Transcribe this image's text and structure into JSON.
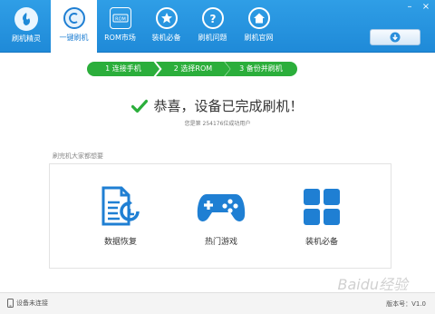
{
  "brand": {
    "name": "刷机精灵"
  },
  "nav": [
    {
      "label": "一键刷机",
      "icon": "flash-c-icon",
      "active": true
    },
    {
      "label": "ROM市场",
      "icon": "rom-chip-icon",
      "active": false
    },
    {
      "label": "装机必备",
      "icon": "star-icon",
      "active": false
    },
    {
      "label": "刷机问题",
      "icon": "question-icon",
      "active": false
    },
    {
      "label": "刷机官网",
      "icon": "home-icon",
      "active": false
    }
  ],
  "window_controls": {
    "minimize": "–",
    "close": "×"
  },
  "steps": [
    {
      "label": "1  连接手机"
    },
    {
      "label": "2  选择ROM"
    },
    {
      "label": "3  备份并刷机"
    }
  ],
  "success": {
    "message": "恭喜，设备已完成刷机！",
    "sub": "您是第 254176位成功用户"
  },
  "panel": {
    "title": "刷完机大家都想要",
    "cards": [
      {
        "label": "数据恢复",
        "icon": "data-recovery-icon"
      },
      {
        "label": "热门游戏",
        "icon": "gamepad-icon"
      },
      {
        "label": "装机必备",
        "icon": "apps-grid-icon"
      }
    ]
  },
  "status": {
    "device": "设备未连接",
    "version": "版本号：V1.0"
  },
  "watermark": "Baidu经验",
  "colors": {
    "top_blue": "#1f8ad8",
    "step_green": "#2bae3b",
    "icon_blue": "#1f7fd3"
  }
}
